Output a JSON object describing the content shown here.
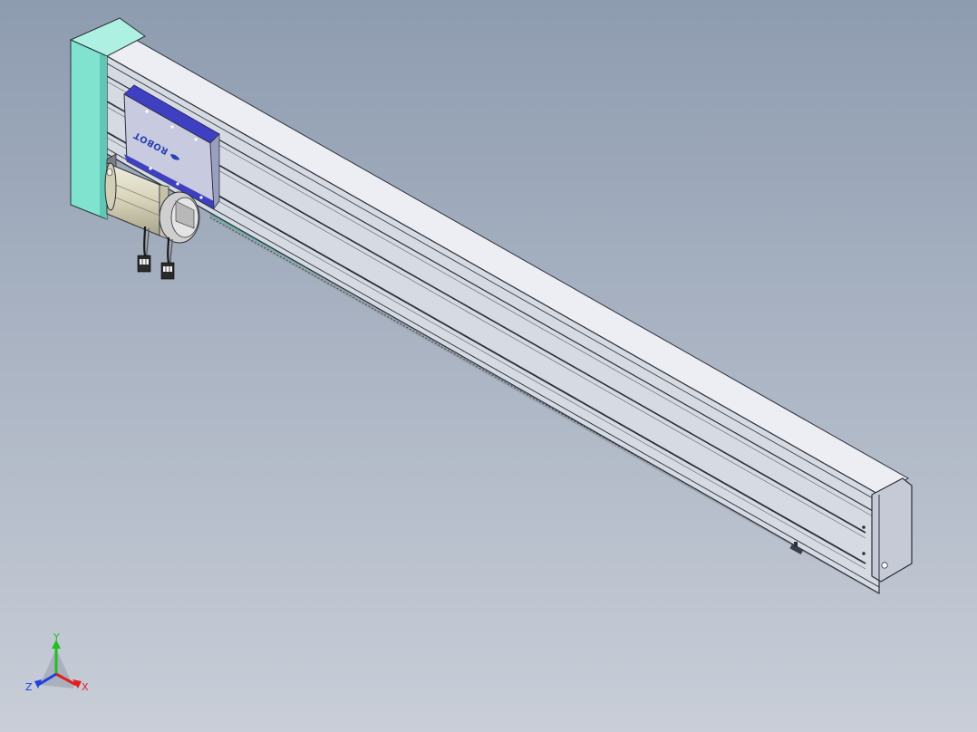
{
  "scene": {
    "background_top": "#8e9cb0",
    "background_bottom": "#c9ced8",
    "rail_color": "#d9dde5",
    "end_cap_color": "#7fe3cf",
    "carriage_plate_color": "#c8cbe0",
    "carriage_edge_color": "#3f3fc2",
    "motor_color": "#d8d4bc",
    "brake_color": "#c9c9c9",
    "belt_color": "#4fb0a0"
  },
  "carriage": {
    "logo_text": "ROBOT"
  },
  "triad": {
    "x_label": "X",
    "y_label": "Y",
    "z_label": "Z",
    "x_color": "#e02020",
    "y_color": "#20c020",
    "z_color": "#2040e0"
  }
}
